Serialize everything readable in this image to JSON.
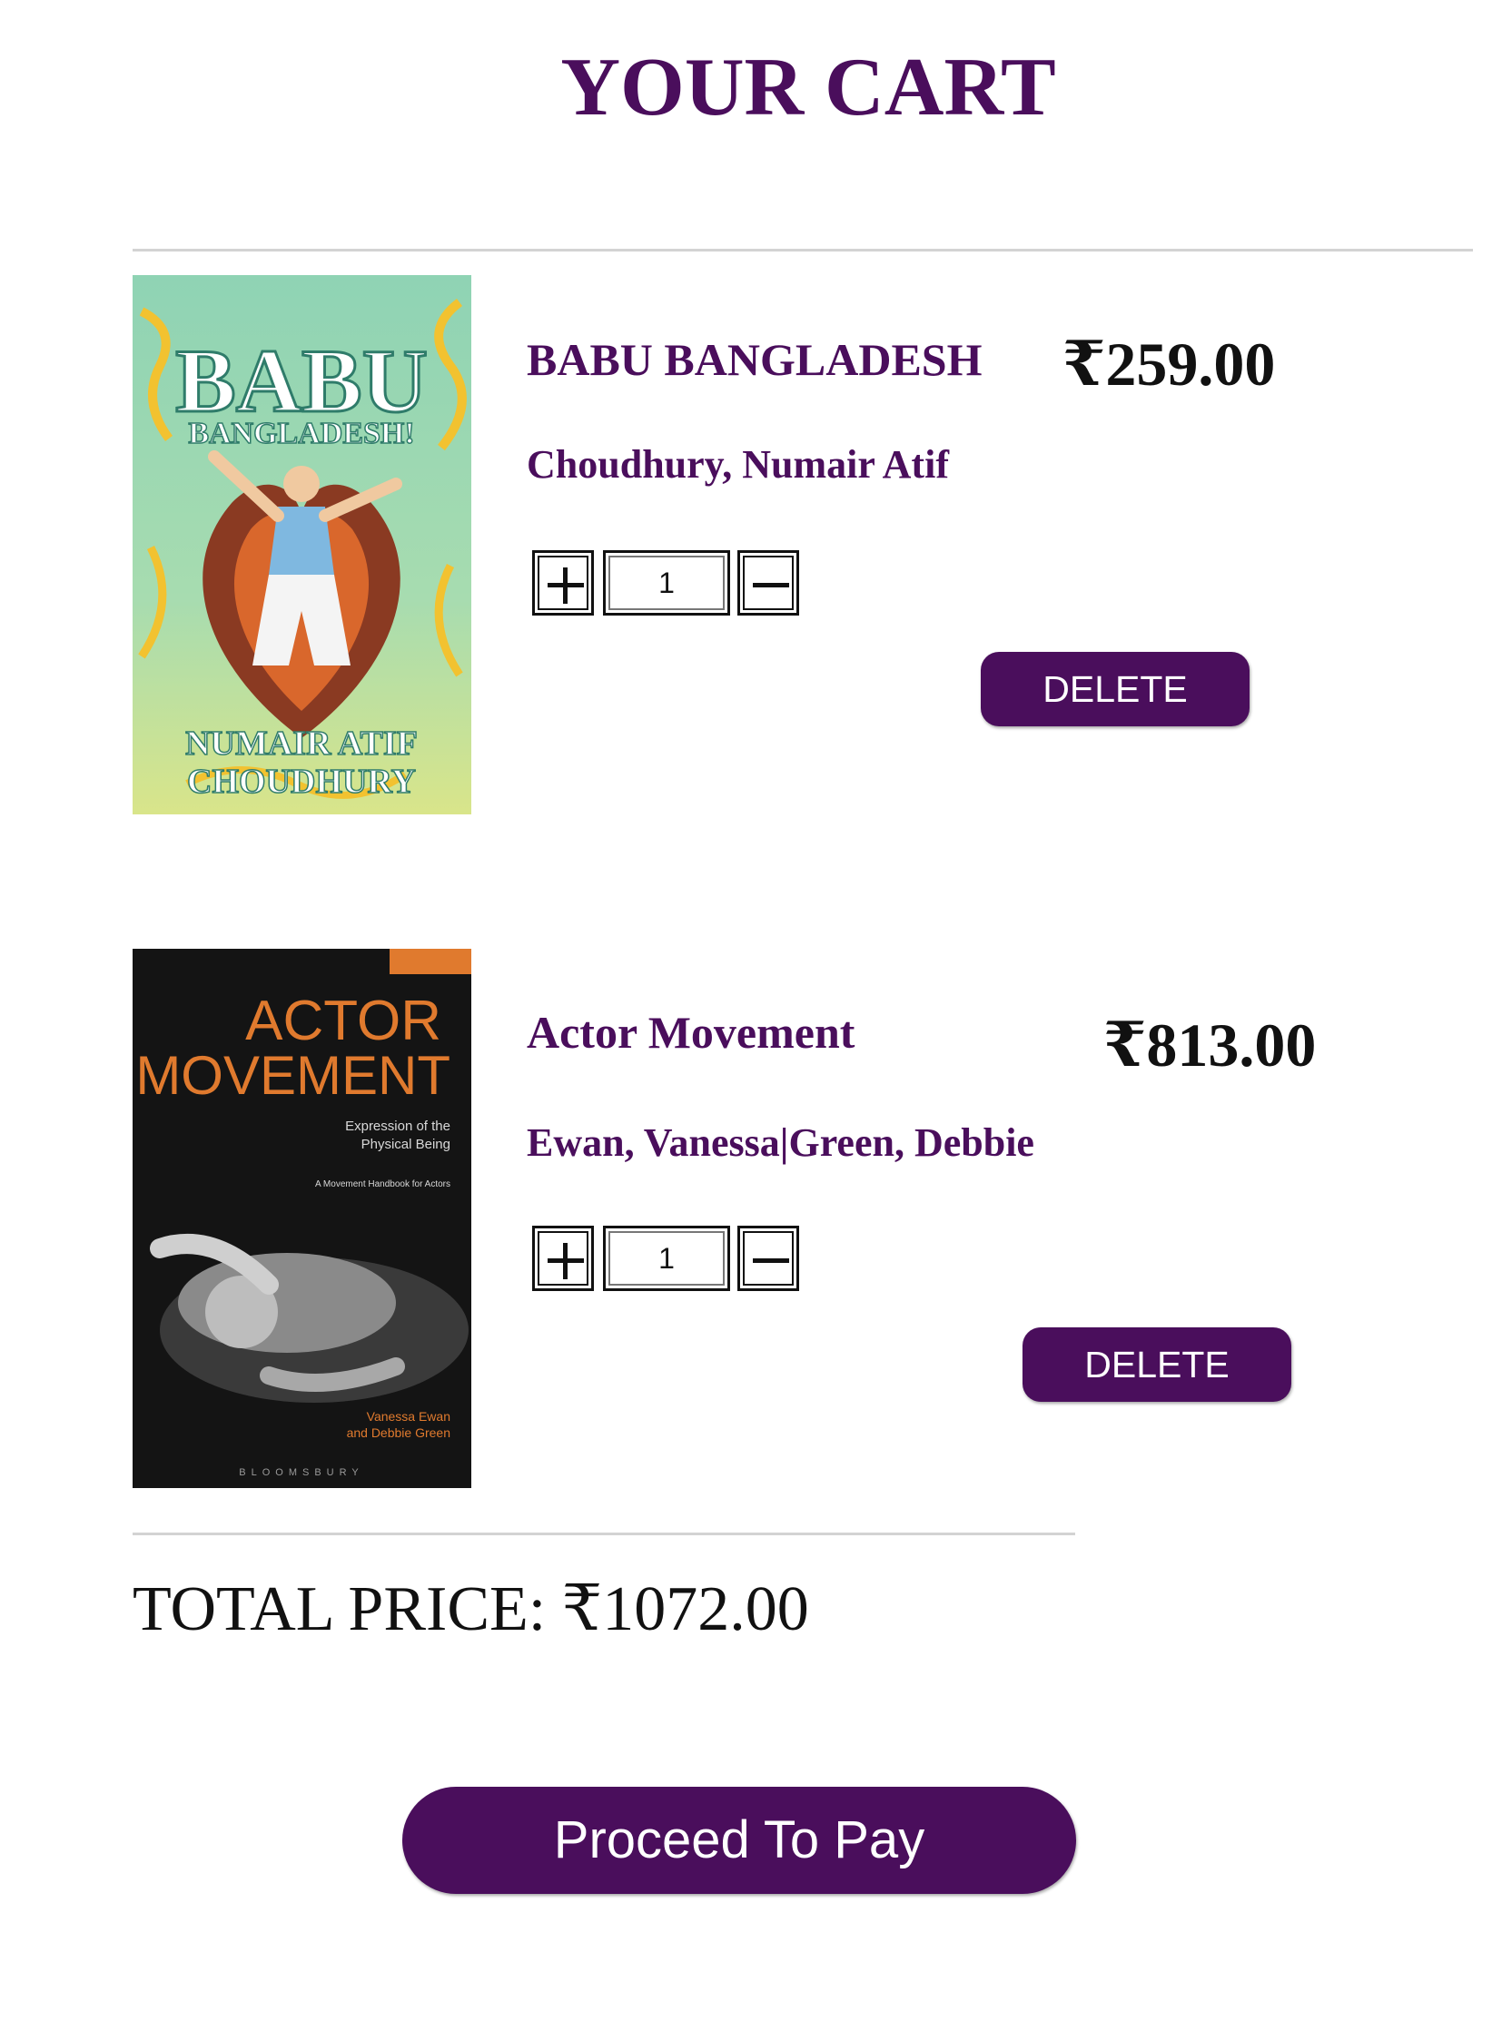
{
  "page": {
    "title": "YOUR CART"
  },
  "cart": {
    "items": [
      {
        "title": "BABU BANGLADESH",
        "author": "Choudhury, Numair Atif",
        "price": "₹259.00",
        "quantity": "1",
        "delete_label": "DELETE",
        "cover": {
          "title_line1": "BABU",
          "title_line2": "BANGLADESH!",
          "author_line1": "NUMAIR ATIF",
          "author_line2": "CHOUDHURY"
        }
      },
      {
        "title": "Actor Movement",
        "author": "Ewan, Vanessa|Green, Debbie",
        "price": "₹813.00",
        "quantity": "1",
        "delete_label": "DELETE",
        "cover": {
          "title_line1": "ACTOR",
          "title_line2": "MOVEMENT",
          "subtitle_line1": "Expression of the",
          "subtitle_line2": "Physical Being",
          "tagline": "A Movement Handbook for Actors",
          "author_line1": "Vanessa Ewan",
          "author_line2": "and Debbie Green",
          "publisher": "BLOOMSBURY"
        }
      }
    ],
    "total_label": "TOTAL PRICE: ₹1072.00",
    "pay_label": "Proceed To Pay"
  },
  "colors": {
    "brand": "#4a0e5c",
    "text": "#111111",
    "divider": "#d3d3d3"
  }
}
